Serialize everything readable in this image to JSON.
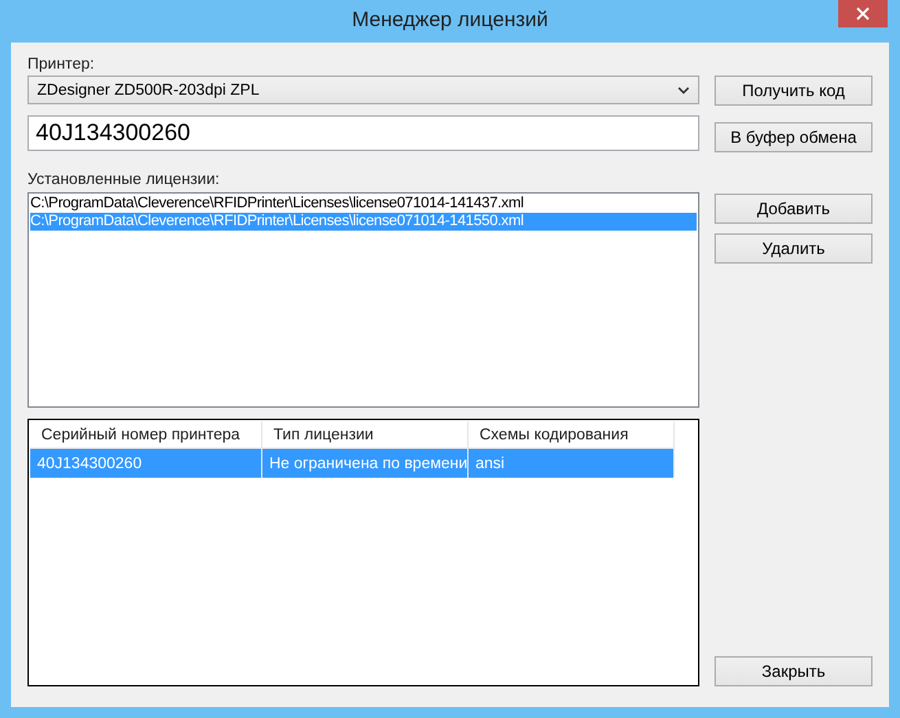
{
  "window": {
    "title": "Менеджер лицензий"
  },
  "printer": {
    "label": "Принтер:",
    "value": "ZDesigner ZD500R-203dpi ZPL"
  },
  "code_field": {
    "value": "40J134300260"
  },
  "licenses": {
    "label": "Установленные лицензии:",
    "items": [
      {
        "text": "C:\\ProgramData\\Cleverence\\RFIDPrinter\\Licenses\\license071014-141437.xml",
        "selected": false
      },
      {
        "text": "C:\\ProgramData\\Cleverence\\RFIDPrinter\\Licenses\\license071014-141550.xml",
        "selected": true
      }
    ]
  },
  "table": {
    "columns": [
      "Серийный номер принтера",
      "Тип лицензии",
      "Схемы кодирования"
    ],
    "rows": [
      {
        "cells": [
          "40J134300260",
          "Не ограничена по времени",
          "ansi"
        ],
        "selected": true
      }
    ]
  },
  "buttons": {
    "get_code": "Получить код",
    "copy": "В буфер обмена",
    "add": "Добавить",
    "remove": "Удалить",
    "close": "Закрыть"
  }
}
